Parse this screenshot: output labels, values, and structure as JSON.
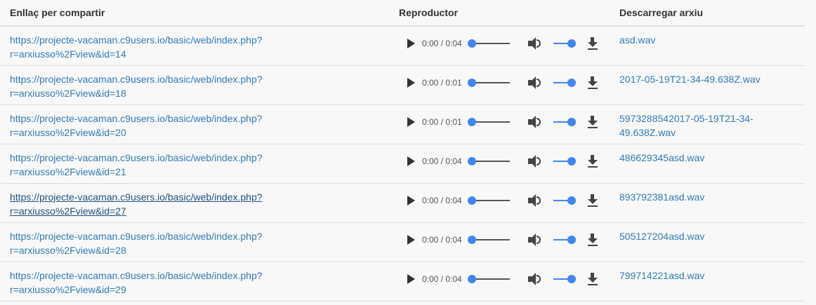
{
  "headers": [
    "Enllaç per compartir",
    "Reproductor",
    "Descarregar arxiu"
  ],
  "rows": [
    {
      "link1": "https://projecte-vacaman.c9users.io/basic/web/index.php?",
      "link2": "r=arxiusso%2Fview&id=14",
      "time": "0:00 / 0:04",
      "file": "asd.wav"
    },
    {
      "link1": "https://projecte-vacaman.c9users.io/basic/web/index.php?",
      "link2": "r=arxiusso%2Fview&id=18",
      "time": "0:00 / 0:01",
      "file": "2017-05-19T21-34-49.638Z.wav"
    },
    {
      "link1": "https://projecte-vacaman.c9users.io/basic/web/index.php?",
      "link2": "r=arxiusso%2Fview&id=20",
      "time": "0:00 / 0:01",
      "file": "5973288542017-05-19T21-34-49.638Z.wav"
    },
    {
      "link1": "https://projecte-vacaman.c9users.io/basic/web/index.php?",
      "link2": "r=arxiusso%2Fview&id=21",
      "time": "0:00 / 0:04",
      "file": "486629345asd.wav"
    },
    {
      "link1": "https://projecte-vacaman.c9users.io/basic/web/index.php?",
      "link2": "r=arxiusso%2Fview&id=27",
      "time": "0:00 / 0:04",
      "file": "893792381asd.wav"
    },
    {
      "link1": "https://projecte-vacaman.c9users.io/basic/web/index.php?",
      "link2": "r=arxiusso%2Fview&id=28",
      "time": "0:00 / 0:04",
      "file": "505127204asd.wav"
    },
    {
      "link1": "https://projecte-vacaman.c9users.io/basic/web/index.php?",
      "link2": "r=arxiusso%2Fview&id=29",
      "time": "0:00 / 0:04",
      "file": "799714221asd.wav"
    }
  ],
  "progress": 0,
  "volume": 1
}
